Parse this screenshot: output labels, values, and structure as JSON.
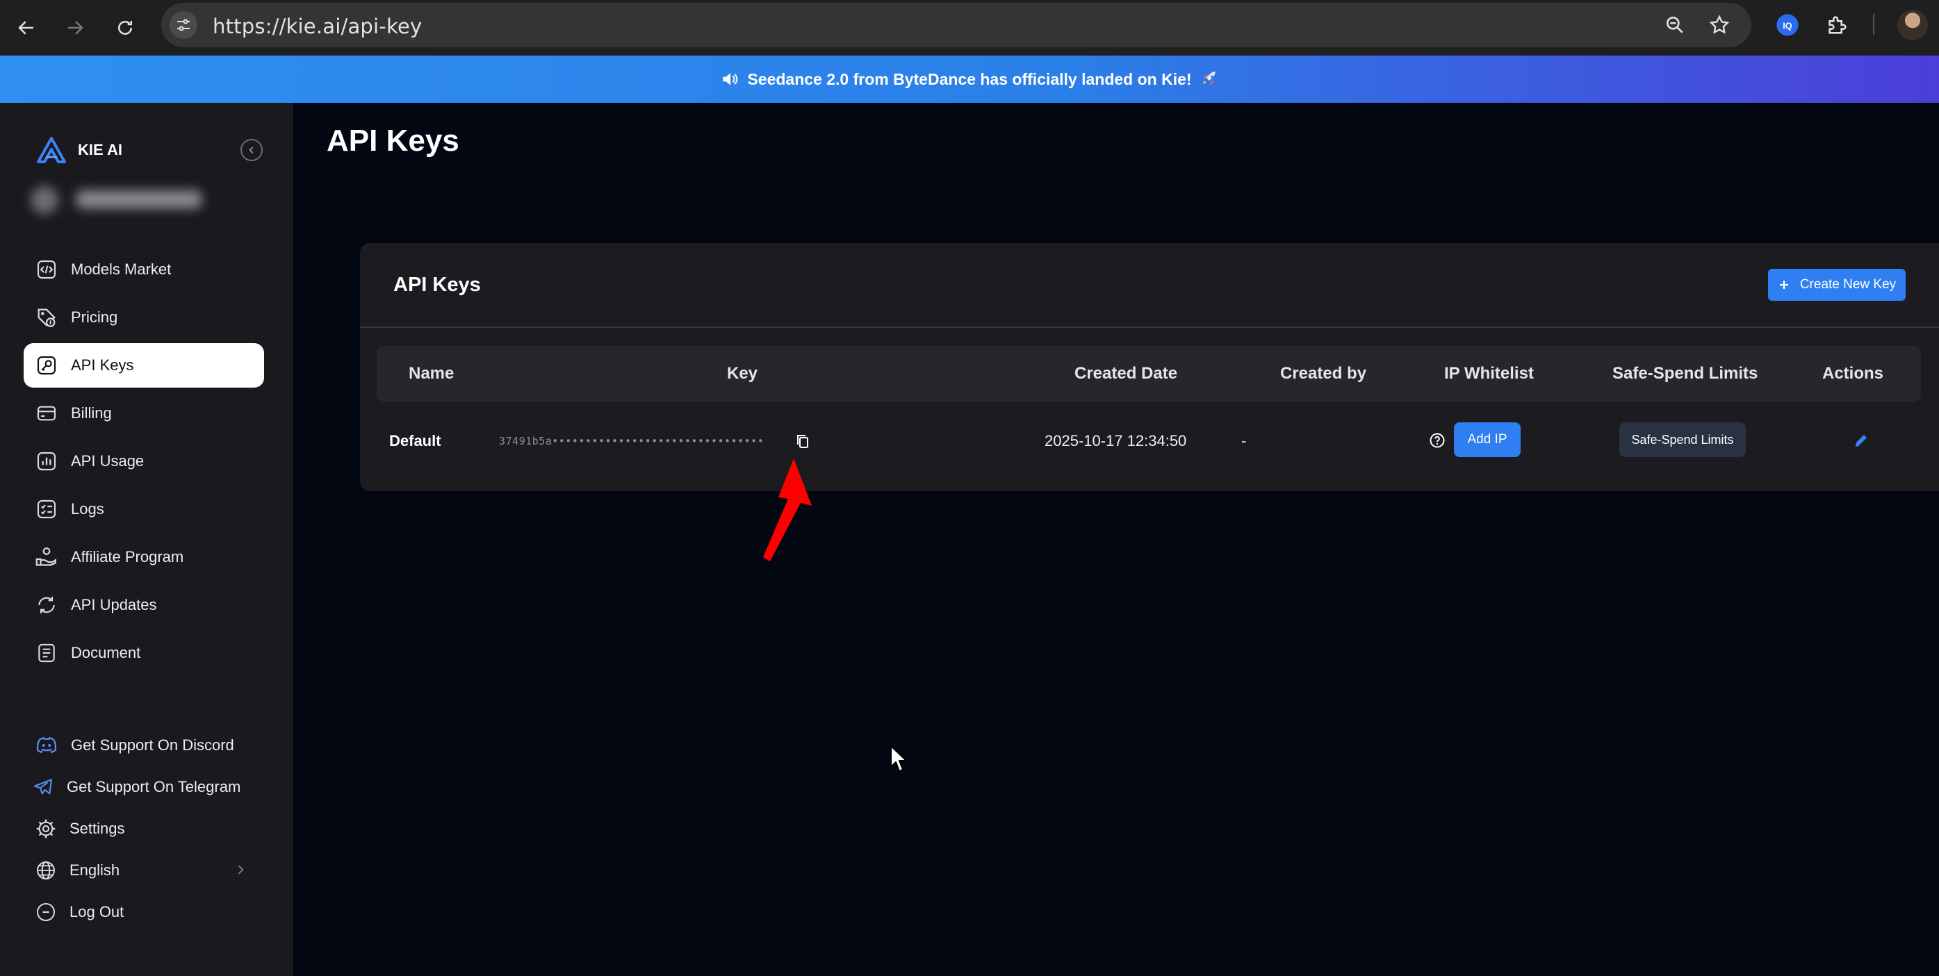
{
  "browser": {
    "url": "https://kie.ai/api-key",
    "icons": [
      "back-icon",
      "forward-icon",
      "reload-icon",
      "site-info-icon",
      "zoom-icon",
      "bookmark-star-icon",
      "extension-iq-icon",
      "extensions-puzzle-icon",
      "profile-avatar"
    ]
  },
  "banner": {
    "text": "Seedance 2.0 from ByteDance has officially landed on Kie!",
    "icons": [
      "speaker-icon",
      "rocket-icon"
    ]
  },
  "sidebar": {
    "brand": "KIE AI",
    "items": [
      {
        "label": "Models Market",
        "icon": "code-icon"
      },
      {
        "label": "Pricing",
        "icon": "price-tag-icon"
      },
      {
        "label": "API Keys",
        "icon": "key-icon",
        "active": true
      },
      {
        "label": "Billing",
        "icon": "card-icon"
      },
      {
        "label": "API Usage",
        "icon": "bar-chart-icon"
      },
      {
        "label": "Logs",
        "icon": "checklist-icon"
      },
      {
        "label": "Affiliate Program",
        "icon": "handshake-icon"
      },
      {
        "label": "API Updates",
        "icon": "refresh-icon"
      },
      {
        "label": "Document",
        "icon": "document-icon"
      }
    ],
    "bottom": [
      {
        "label": "Get Support On Discord",
        "icon": "discord-icon"
      },
      {
        "label": "Get Support On Telegram",
        "icon": "telegram-icon"
      },
      {
        "label": "Settings",
        "icon": "gear-icon"
      },
      {
        "label": "English",
        "icon": "globe-icon"
      },
      {
        "label": "Log Out",
        "icon": "logout-icon"
      }
    ]
  },
  "main": {
    "page_title": "API Keys",
    "card": {
      "title": "API Keys",
      "create_button": "Create New Key",
      "columns": [
        "Name",
        "Key",
        "Created Date",
        "Created by",
        "IP Whitelist",
        "Safe-Spend Limits",
        "Actions"
      ],
      "rows": [
        {
          "name": "Default",
          "key_masked": "37491b5a••••••••••••••••••••••••••••••••",
          "created_date": "2025-10-17 12:34:50",
          "created_by": "-",
          "ip_button": "Add IP",
          "limits_button": "Safe-Spend Limits"
        }
      ]
    }
  },
  "colors": {
    "accent": "#2f7ef2",
    "background": "#030712",
    "sidebar": "#19191e",
    "card": "#1c1c20",
    "annotation": "#ff0000"
  }
}
